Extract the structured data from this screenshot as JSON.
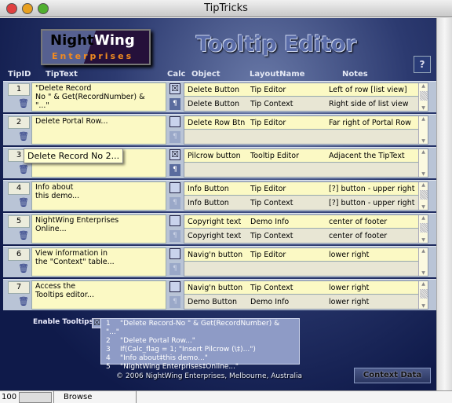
{
  "window": {
    "title": "TipTricks"
  },
  "header": {
    "logo_line1a": "Night",
    "logo_line1b": "Wing",
    "logo_line2": "Enterprises",
    "title": "Tooltip Editor",
    "help_label": "?"
  },
  "columns": {
    "tipid": "TipID",
    "tiptext": "TipText",
    "calc": "Calc",
    "object": "Object",
    "layout": "LayoutName",
    "notes": "Notes"
  },
  "rows": [
    {
      "id": "1",
      "text": "\"Delete Record\nNo \" & Get(RecordNumber) &\n\"...\"",
      "calc": true,
      "portal": [
        [
          "Delete Button",
          "Tip Editor",
          "Left of row [list view]"
        ],
        [
          "Delete Button",
          "Tip Context",
          "Right side of list view"
        ]
      ]
    },
    {
      "id": "2",
      "text": "Delete Portal Row...",
      "calc": false,
      "portal": [
        [
          "Delete Row Btn",
          "Tip Editor",
          "Far right of Portal Row"
        ]
      ]
    },
    {
      "id": "3",
      "text": "Insert Pilcrow",
      "calc": true,
      "portal": [
        [
          "Pilcrow button",
          "Tooltip Editor",
          "Adjacent the TipText"
        ]
      ]
    },
    {
      "id": "4",
      "text": "Info about\nthis demo...",
      "calc": false,
      "portal": [
        [
          "Info Button",
          "Tip Editor",
          "[?] button - upper right"
        ],
        [
          "Info Button",
          "Tip Context",
          "[?] button - upper right"
        ]
      ]
    },
    {
      "id": "5",
      "text": "NightWing Enterprises\nOnline...",
      "calc": false,
      "portal": [
        [
          "Copyright text",
          "Demo Info",
          "center of footer"
        ],
        [
          "Copyright text",
          "Tip Context",
          "center of footer"
        ]
      ]
    },
    {
      "id": "6",
      "text": "View information in\nthe \"Context\" table...",
      "calc": false,
      "portal": [
        [
          "Navig'n button",
          "Tip Editor",
          "lower right"
        ]
      ]
    },
    {
      "id": "7",
      "text": "Access the\nTooltips editor...",
      "calc": false,
      "portal": [
        [
          "Navig'n button",
          "Tip Context",
          "lower right"
        ],
        [
          "Demo Button",
          "Demo Info",
          "lower right"
        ]
      ]
    }
  ],
  "tooltip": "Delete Record No 2...",
  "footer": {
    "enable_label": "Enable Tooltips",
    "enable_checked": true,
    "list": [
      [
        "1",
        "\"Delete Record-No \" & Get(RecordNumber) & \"...\""
      ],
      [
        "2",
        "\"Delete Portal Row...\""
      ],
      [
        "3",
        "If(Calc_flag = 1; \"Insert Pilcrow (\\‡)...\")"
      ],
      [
        "4",
        "\"Info about‡this demo...\""
      ],
      [
        "5",
        "\"NightWing Enterprises‡Online...\""
      ]
    ],
    "copyright": "© 2006 NightWing Enterprises, Melbourne, Australia",
    "context_button": "Context Data"
  },
  "status": {
    "zoom": "100",
    "mode": "Browse"
  }
}
